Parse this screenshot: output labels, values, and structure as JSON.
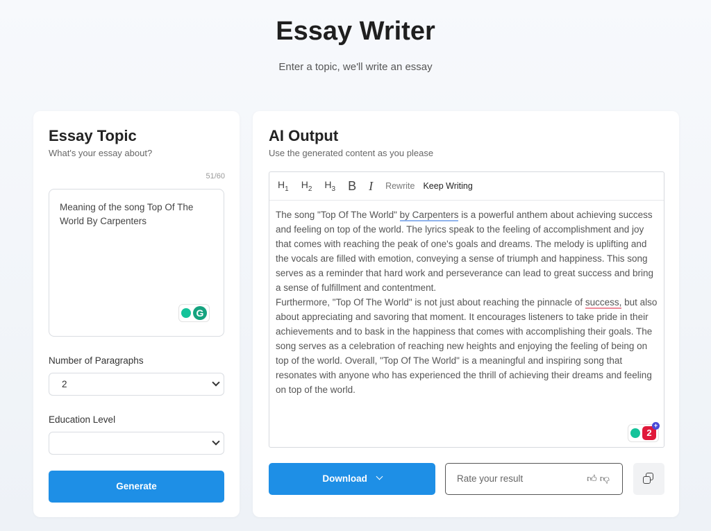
{
  "header": {
    "title": "Essay Writer",
    "subtitle": "Enter a topic, we'll write an essay"
  },
  "topic_panel": {
    "title": "Essay Topic",
    "subtitle": "What's your essay about?",
    "counter": "51/60",
    "topic_value": "Meaning of the song Top Of The World By Carpenters",
    "paragraphs_label": "Number of Paragraphs",
    "paragraphs_value": "2",
    "education_label": "Education Level",
    "education_value": "",
    "generate_label": "Generate"
  },
  "output_panel": {
    "title": "AI Output",
    "subtitle": "Use the generated content as you please",
    "toolbar": {
      "h1": "H",
      "h2": "H",
      "h3": "H",
      "h1_sub": "1",
      "h2_sub": "2",
      "h3_sub": "3",
      "bold": "B",
      "italic": "I",
      "rewrite": "Rewrite",
      "keep_writing": "Keep Writing"
    },
    "paragraph1": {
      "a": "The song \"Top Of The World\" ",
      "b": "by Carpenters",
      "c": " is a powerful anthem about achieving success and feeling on top of the world. The lyrics speak to the feeling of accomplishment and joy that comes with reaching the peak of one's goals and dreams. The melody is uplifting and the vocals are filled with emotion, conveying a sense of triumph and happiness. This song serves as a reminder that hard work and perseverance can lead to great success and bring a sense of fulfillment and contentment."
    },
    "paragraph2": {
      "a": "Furthermore, \"Top Of The World\" is not just about reaching the pinnacle of ",
      "b": "success,",
      "c": " but also about appreciating and savoring that moment. It encourages listeners to take pride in their achievements and to bask in the happiness that comes with accomplishing their goals. The song serves as a celebration of reaching new heights and enjoying the feeling of being on top of the world. Overall, \"Top Of The World\" is a meaningful and inspiring song that resonates with anyone who has experienced the thrill of achieving their dreams and feeling on top of the world."
    },
    "grammarly_count": "2",
    "download_label": "Download",
    "rate_placeholder": "Rate your result"
  },
  "colors": {
    "accent": "#1e8fe6",
    "grammarly_green": "#15c39a",
    "grammarly_red": "#e0193a"
  }
}
